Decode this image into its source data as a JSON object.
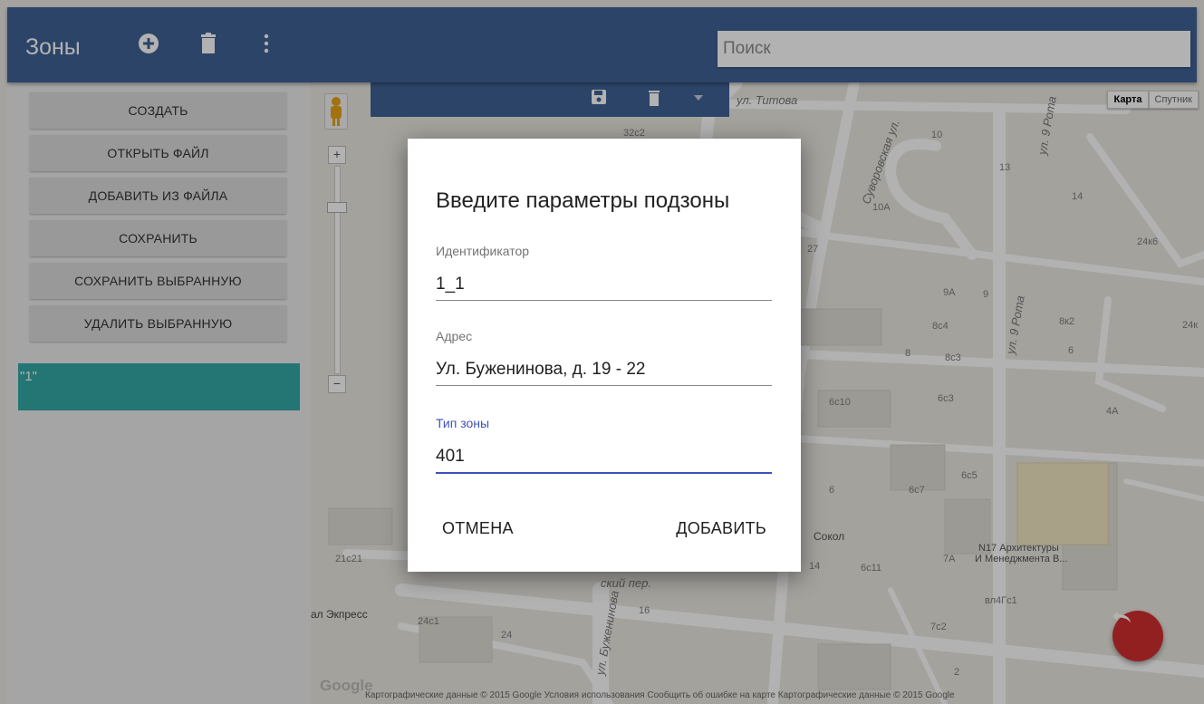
{
  "header": {
    "title": "Зоны",
    "icons": [
      "add-circle-icon",
      "trash-icon",
      "more-vert-icon"
    ],
    "search_placeholder": "Поиск"
  },
  "sidebar": {
    "buttons": [
      "СОЗДАТЬ",
      "ОТКРЫТЬ ФАЙЛ",
      "ДОБАВИТЬ ИЗ ФАЙЛА",
      "СОХРАНИТЬ",
      "СОХРАНИТЬ ВЫБРАННУЮ",
      "УДАЛИТЬ ВЫБРАННУЮ"
    ],
    "zones": [
      "\"1\""
    ]
  },
  "map": {
    "toolbar_icons": [
      "save-icon",
      "trash-icon",
      "dropdown-icon"
    ],
    "map_type": [
      "Карта",
      "Спутник"
    ],
    "streets": [
      "ул. Титова",
      "Суворовская ул.",
      "ул. 9 Рота",
      "ул. 9 Рота",
      "ул. Буженинова",
      "ский пер."
    ],
    "labels": [
      "32с2",
      "10",
      "13",
      "14",
      "10А",
      "24к6",
      "27",
      "9А",
      "9",
      "8с4",
      "8к2",
      "24к",
      "8",
      "8с3",
      "6",
      "6с10",
      "6с3",
      "4А",
      "6",
      "6с7",
      "6с5",
      "Сокол",
      "14",
      "6с11",
      "7А",
      "N17 Архитектуры",
      "И Менеджмента В...",
      "вл4Гс1",
      "7с2",
      "21с21",
      "ал Экпресс",
      "24с1",
      "24",
      "16",
      "2"
    ],
    "attribution": "Картографические данные © 2015 Google   Условия использования   Сообщить об ошибке на карте  Картографические данные © 2015 Google",
    "google_logo": "Google",
    "fab_icon": "undo-icon"
  },
  "dialog": {
    "title": "Введите параметры подзоны",
    "fields": [
      {
        "label": "Идентификатор",
        "value": "1_1"
      },
      {
        "label": "Адрес",
        "value": "Ул. Буженинова, д. 19 - 22"
      },
      {
        "label": "Тип зоны",
        "value": "401"
      }
    ],
    "cancel": "ОТМЕНА",
    "add": "ДОБАВИТЬ"
  },
  "colors": {
    "primary": "#3f6296",
    "accent": "#34a9a6",
    "fab": "#d32f2f",
    "focus": "#3f51b5"
  }
}
